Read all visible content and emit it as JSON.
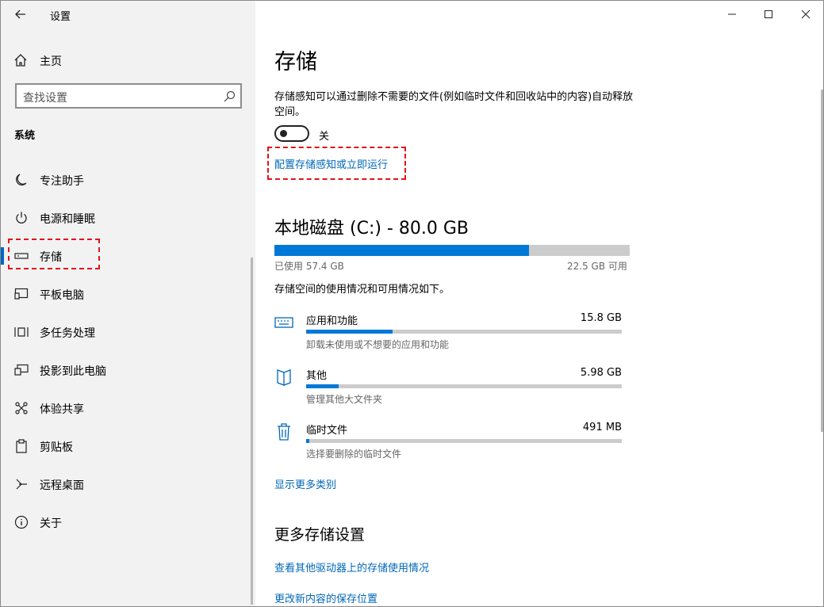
{
  "window": {
    "title": "设置",
    "controls": {
      "minimize": "minimize-icon",
      "maximize": "maximize-icon",
      "close": "close-icon"
    }
  },
  "sidebar": {
    "home_label": "主页",
    "search_placeholder": "查找设置",
    "section_label": "系统",
    "items": [
      {
        "label": "专注助手",
        "icon": "moon-icon"
      },
      {
        "label": "电源和睡眠",
        "icon": "power-icon"
      },
      {
        "label": "存储",
        "icon": "storage-drive-icon",
        "active": true
      },
      {
        "label": "平板电脑",
        "icon": "tablet-icon"
      },
      {
        "label": "多任务处理",
        "icon": "multitask-icon"
      },
      {
        "label": "投影到此电脑",
        "icon": "project-icon"
      },
      {
        "label": "体验共享",
        "icon": "share-icon"
      },
      {
        "label": "剪贴板",
        "icon": "clipboard-icon"
      },
      {
        "label": "远程桌面",
        "icon": "remote-desktop-icon"
      },
      {
        "label": "关于",
        "icon": "info-icon"
      }
    ]
  },
  "main": {
    "title": "存储",
    "storage_sense_desc": "存储感知可以通过删除不需要的文件(例如临时文件和回收站中的内容)自动释放空间。",
    "toggle_state_label": "关",
    "toggle_on": false,
    "configure_link": "配置存储感知或立即运行",
    "disk": {
      "title": "本地磁盘 (C:) - 80.0 GB",
      "used_label": "已使用 57.4 GB",
      "free_label": "22.5 GB 可用",
      "used_fraction": 0.7175
    },
    "usage_desc": "存储空间的使用情况和可用情况如下。",
    "categories": [
      {
        "name": "应用和功能",
        "size": "15.8 GB",
        "desc": "卸载未使用或不想要的应用和功能",
        "icon": "keyboard-apps-icon",
        "fraction": 0.275
      },
      {
        "name": "其他",
        "size": "5.98 GB",
        "desc": "管理其他大文件夹",
        "icon": "folder-other-icon",
        "fraction": 0.104
      },
      {
        "name": "临时文件",
        "size": "491 MB",
        "desc": "选择要删除的临时文件",
        "icon": "trash-icon",
        "fraction": 0.009
      }
    ],
    "show_more_link": "显示更多类别",
    "more_settings_title": "更多存储设置",
    "more_links": [
      "查看其他驱动器上的存储使用情况",
      "更改新内容的保存位置"
    ]
  },
  "colors": {
    "accent": "#0078d7",
    "link": "#0067b8",
    "highlight_box": "#e0151b"
  }
}
